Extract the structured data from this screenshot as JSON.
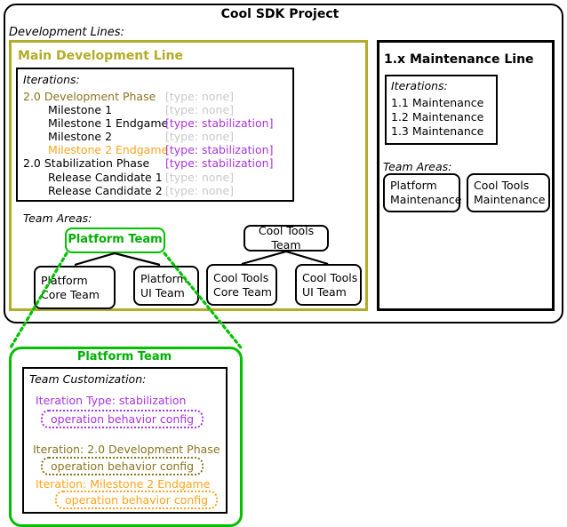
{
  "project": {
    "title": "Cool SDK Project",
    "development_lines_label": "Development Lines:"
  },
  "colors": {
    "olive": "#8a7420",
    "line_title": "#b3ac28",
    "orange": "#ffa31a",
    "purple": "#a933e0",
    "gray": "#c9c9c9",
    "green": "#00c000",
    "black": "#000000"
  },
  "main_line": {
    "title": "Main Development Line",
    "iterations_label": "Iterations:",
    "iterations": [
      {
        "name": "2.0 Development Phase",
        "type": "[type: none]",
        "level": 1,
        "color": "olive"
      },
      {
        "name": "Milestone 1",
        "type": "[type: none]",
        "level": 2,
        "color": "black"
      },
      {
        "name": "Milestone 1 Endgame",
        "type": "[type: stabilization]",
        "level": 2,
        "color": "black"
      },
      {
        "name": "Milestone 2",
        "type": "[type: none]",
        "level": 2,
        "color": "black"
      },
      {
        "name": "Milestone 2 Endgame",
        "type": "[type: stabilization]",
        "level": 2,
        "color": "orange"
      },
      {
        "name": "2.0 Stabilization Phase",
        "type": "[type: stabilization]",
        "level": 1,
        "color": "black"
      },
      {
        "name": "Release Candidate 1",
        "type": "[type: none]",
        "level": 2,
        "color": "black"
      },
      {
        "name": "Release Candidate 2",
        "type": "[type: none]",
        "level": 2,
        "color": "black"
      }
    ],
    "team_areas_label": "Team Areas:",
    "team_areas": {
      "platform_team": "Platform Team",
      "platform_core_team": "Platform\nCore Team",
      "platform_core_team_l1": "Platform",
      "platform_core_team_l2": "Core Team",
      "platform_ui_team_l1": "Platform",
      "platform_ui_team_l2": "UI Team",
      "cooltools_team": "Cool Tools Team",
      "cooltools_core_team_l1": "Cool Tools",
      "cooltools_core_team_l2": "Core Team",
      "cooltools_ui_team_l1": "Cool Tools",
      "cooltools_ui_team_l2": "UI Team"
    }
  },
  "maintenance_line": {
    "title": "1.x Maintenance Line",
    "iterations_label": "Iterations:",
    "iterations": [
      "1.1 Maintenance",
      "1.2 Maintenance",
      "1.3 Maintenance"
    ],
    "team_areas_label": "Team Areas:",
    "team_areas": {
      "platform_maintenance_l1": "Platform",
      "platform_maintenance_l2": "Maintenance",
      "cooltools_maintenance_l1": "Cool Tools",
      "cooltools_maintenance_l2": "Maintenance"
    }
  },
  "detail_panel": {
    "title": "Platform Team",
    "customization_label": "Team Customization:",
    "entries": [
      {
        "label": "Iteration Type: stabilization",
        "pill": "operation behavior config",
        "color": "purple"
      },
      {
        "label": "Iteration: 2.0 Development Phase",
        "pill": "operation behavior config",
        "color": "olive"
      },
      {
        "label": "Iteration: Milestone 2 Endgame",
        "pill": "operation behavior config",
        "color": "orange"
      }
    ]
  }
}
